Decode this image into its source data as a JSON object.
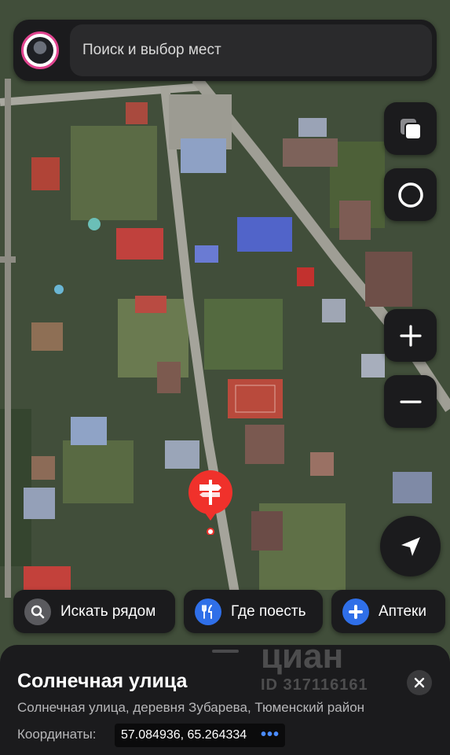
{
  "search": {
    "placeholder": "Поиск и выбор мест"
  },
  "map_controls": {
    "layers": "layers-icon",
    "mode": "ring-icon",
    "zoom_in": "plus-icon",
    "zoom_out": "minus-icon",
    "locate": "navigation-arrow-icon"
  },
  "chips": [
    {
      "label": "Искать рядом",
      "icon": "search-icon",
      "color": "#5a5a5e"
    },
    {
      "label": "Где поесть",
      "icon": "fork-knife-icon",
      "color": "#2f6fe8"
    },
    {
      "label": "Аптеки",
      "icon": "cross-icon",
      "color": "#2f6fe8"
    }
  ],
  "place": {
    "title": "Солнечная улица",
    "address": "Солнечная улица, деревня Зубарева, Тюменский район",
    "coords_label": "Координаты:",
    "coords_value": "57.084936, 65.264334",
    "more": "•••"
  },
  "watermark": {
    "brand": "циан",
    "id": "ID 317116161"
  },
  "colors": {
    "pin": "#f0312b",
    "accent": "#2f6fe8",
    "panel": "#1b1b1d"
  }
}
